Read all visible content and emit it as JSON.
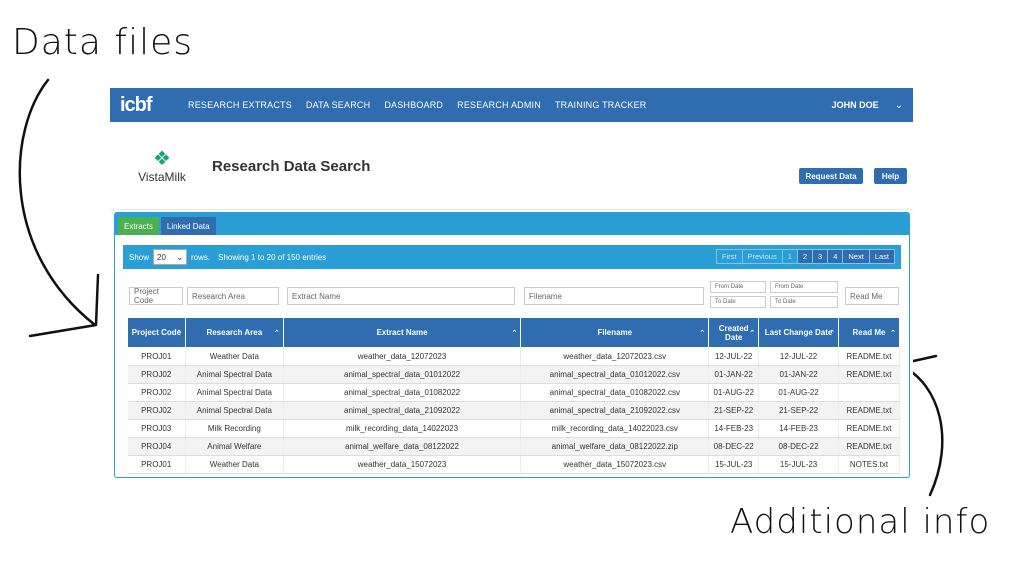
{
  "annotations": {
    "data_files": "Data files",
    "additional_info": "Additional info"
  },
  "nav": {
    "logo": "icbf",
    "items": [
      "RESEARCH EXTRACTS",
      "DATA SEARCH",
      "DASHBOARD",
      "RESEARCH ADMIN",
      "TRAINING TRACKER"
    ],
    "user": "JOHN DOE",
    "chevron": "⌄"
  },
  "header": {
    "brand_mark": "❖",
    "brand_name": "VistaMilk",
    "title": "Research Data Search",
    "request_button": "Request Data",
    "help_button": "Help"
  },
  "tabs": [
    "Extracts",
    "Linked Data"
  ],
  "controls": {
    "show": "Show",
    "rows_value": "20",
    "rows_arrow": "⌄",
    "rows": "rows.",
    "showing": "Showing 1 to 20 of 150 entries",
    "pager": [
      "First",
      "Previous",
      "1",
      "2",
      "3",
      "4",
      "Next",
      "Last"
    ]
  },
  "filters": {
    "project_code": "Project Code",
    "research_area": "Research Area",
    "extract_name": "Extract Name",
    "filename": "Filename",
    "created_from": "From Date",
    "created_to": "To Date",
    "changed_from": "From Date",
    "changed_to": "To Date",
    "read_me": "Read Me"
  },
  "table": {
    "headers": [
      "Project Code",
      "Research Area",
      "Extract Name",
      "Filename",
      "Created Date",
      "Last Change Date",
      "Read Me"
    ],
    "sort_icon": "⌃",
    "rows": [
      [
        "PROJ01",
        "Weather Data",
        "weather_data_12072023",
        "weather_data_12072023.csv",
        "12-JUL-22",
        "12-JUL-22",
        "README.txt"
      ],
      [
        "PROJ02",
        "Animal Spectral Data",
        "animal_spectral_data_01012022",
        "animal_spectral_data_01012022.csv",
        "01-JAN-22",
        "01-JAN-22",
        "README.txt"
      ],
      [
        "PROJ02",
        "Animal Spectral Data",
        "animal_spectral_data_01082022",
        "animal_spectral_data_01082022.csv",
        "01-AUG-22",
        "01-AUG-22",
        ""
      ],
      [
        "PROJ02",
        "Animal Spectral Data",
        "animal_spectral_data_21092022",
        "animal_spectral_data_21092022.csv",
        "21-SEP-22",
        "21-SEP-22",
        "README.txt"
      ],
      [
        "PROJ03",
        "Milk Recording",
        "milk_recording_data_14022023",
        "milk_recording_data_14022023.csv",
        "14-FEB-23",
        "14-FEB-23",
        "README.txt"
      ],
      [
        "PROJ04",
        "Animal Welfare",
        "animal_welfare_data_08122022",
        "animal_welfare_data_08122022.zip",
        "08-DEC-22",
        "08-DEC-22",
        "README.txt"
      ],
      [
        "PROJ01",
        "Weather Data",
        "weather_data_15072023",
        "weather_data_15072023.csv",
        "15-JUL-23",
        "15-JUL-23",
        "NOTES.txt"
      ]
    ]
  }
}
